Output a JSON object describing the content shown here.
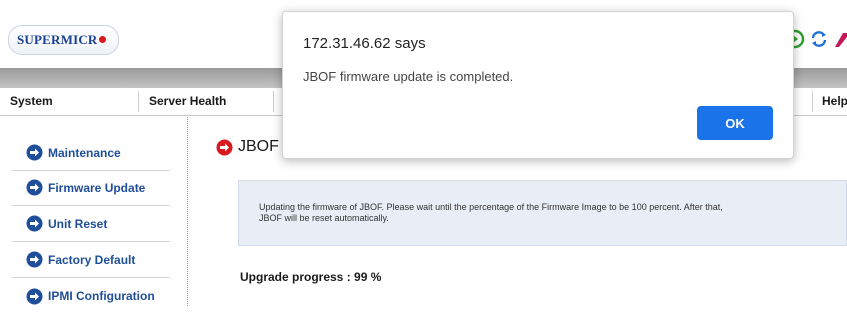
{
  "brand": {
    "logo_text": "SUPERMICR"
  },
  "nav": {
    "items": [
      "System",
      "Server Health",
      "Help"
    ]
  },
  "sidebar": {
    "items": [
      {
        "label": "Maintenance"
      },
      {
        "label": "Firmware Update"
      },
      {
        "label": "Unit Reset"
      },
      {
        "label": "Factory Default"
      },
      {
        "label": "IPMI Configuration"
      }
    ]
  },
  "main": {
    "title": "JBOF",
    "info": "Updating the firmware of JBOF. Please wait until the percentage of the Firmware Image to be 100 percent. After that, JBOF will be reset automatically.",
    "progress_label": "Upgrade progress : 99 %",
    "progress_percent": 99
  },
  "dialog": {
    "title": "172.31.46.62 says",
    "message": "JBOF firmware update is completed.",
    "ok_label": "OK"
  },
  "colors": {
    "accent_blue": "#1a73e8",
    "link_blue": "#1f4e9a",
    "brand_red": "#d71920",
    "icon_green": "#2e9e2e",
    "icon_blue": "#1e6fd9",
    "icon_magenta": "#c2185b"
  },
  "icons": [
    "refresh-icon",
    "sync-icon",
    "logout-icon",
    "arrow-right-icon",
    "stop-arrow-icon"
  ]
}
